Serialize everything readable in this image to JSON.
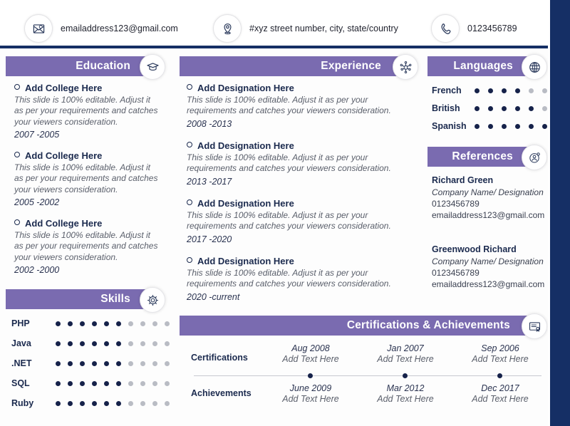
{
  "theme": {
    "accent_purple": "#7a6bb0",
    "navy": "#152f65",
    "dot_on": "#16224a",
    "dot_off": "#b9bcc4"
  },
  "header": {
    "contacts": [
      {
        "icon": "envelope-icon",
        "text": "emailaddress123@gmail.com"
      },
      {
        "icon": "map-pin-icon",
        "text": "#xyz street number, city, state/country"
      },
      {
        "icon": "phone-icon",
        "text": "0123456789"
      }
    ]
  },
  "education": {
    "title": "Education",
    "icon": "graduation-cap-icon",
    "entries": [
      {
        "title": "Add College Here",
        "description": "This slide is 100% editable.  Adjust it as per your requirements and catches your viewers consideration.",
        "date": "2007 -2005"
      },
      {
        "title": "Add College Here",
        "description": "This slide is 100% editable.  Adjust it as per your requirements and catches your viewers consideration.",
        "date": "2005 -2002"
      },
      {
        "title": "Add College Here",
        "description": "This slide is 100% editable.  Adjust it as per your requirements and catches your viewers consideration.",
        "date": "2002 -2000"
      }
    ]
  },
  "experience": {
    "title": "Experience",
    "icon": "network-node-icon",
    "entries": [
      {
        "title": "Add Designation Here",
        "description": "This slide is 100% editable.  Adjust it as per your requirements and catches your viewers consideration.",
        "date": "2008 -2013"
      },
      {
        "title": "Add Designation Here",
        "description": "This slide is 100% editable.  Adjust it as per your requirements and catches your viewers consideration.",
        "date": "2013 -2017"
      },
      {
        "title": "Add Designation Here",
        "description": "This slide is 100% editable.  Adjust it as per your requirements and catches your viewers consideration.",
        "date": "2017 -2020"
      },
      {
        "title": "Add Designation Here",
        "description": "This slide is 100% editable.  Adjust it as per your requirements and catches your viewers consideration.",
        "date": "2020 -current"
      }
    ]
  },
  "languages": {
    "title": "Languages",
    "icon": "globe-icon",
    "max": 6,
    "items": [
      {
        "label": "French",
        "value": 4
      },
      {
        "label": "British",
        "value": 5
      },
      {
        "label": "Spanish",
        "value": 6
      }
    ]
  },
  "references": {
    "title": "References",
    "icon": "user-badge-icon",
    "items": [
      {
        "name": "Richard Green",
        "role": "Company Name/ Designation",
        "phone": "0123456789",
        "email": "emailaddress123@gmail.com"
      },
      {
        "name": "Greenwood Richard",
        "role": "Company Name/ Designation",
        "phone": "0123456789",
        "email": "emailaddress123@gmail.com"
      }
    ]
  },
  "skills": {
    "title": "Skills",
    "icon": "gear-icon",
    "max": 10,
    "items": [
      {
        "label": "PHP",
        "value": 6
      },
      {
        "label": "Java",
        "value": 6
      },
      {
        "label": ".NET",
        "value": 6
      },
      {
        "label": "SQL",
        "value": 6
      },
      {
        "label": "Ruby",
        "value": 6
      }
    ]
  },
  "certifications": {
    "title": "Certifications & Achievements",
    "icon": "certificate-icon",
    "row_labels": [
      "Certifications",
      "Achievements"
    ],
    "certifications": [
      {
        "date": "Aug 2008",
        "text": "Add Text Here"
      },
      {
        "date": "Jan 2007",
        "text": "Add Text Here"
      },
      {
        "date": "Sep 2006",
        "text": "Add Text Here"
      }
    ],
    "achievements": [
      {
        "date": "June 2009",
        "text": "Add Text Here"
      },
      {
        "date": "Mar 2012",
        "text": "Add Text Here"
      },
      {
        "date": "Dec 2017",
        "text": "Add Text Here"
      }
    ]
  }
}
